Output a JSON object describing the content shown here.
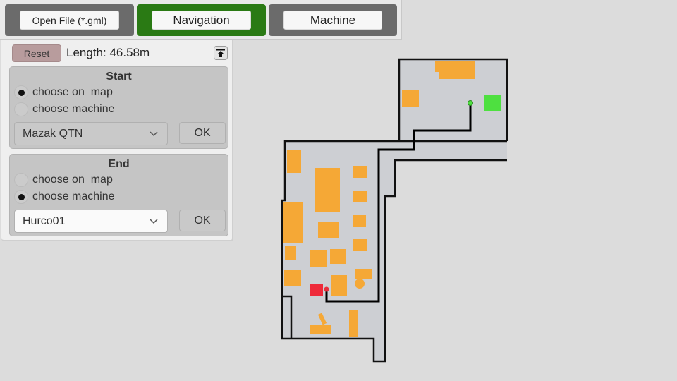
{
  "toolbar": {
    "tabs": [
      {
        "label": "Open File (*.gml)",
        "active": false
      },
      {
        "label": "Navigation",
        "active": true
      },
      {
        "label": "Machine",
        "active": false
      }
    ],
    "active_color": "#2a7a14",
    "inactive_color": "#6b6b6b"
  },
  "panel": {
    "reset_label": "Reset",
    "length_text": "Length: 46.58m",
    "collapse_icon": "collapse-up-arrow-icon",
    "start": {
      "title": "Start",
      "options": [
        {
          "label": "choose on  map",
          "selected": true
        },
        {
          "label": "choose machine",
          "selected": false
        }
      ],
      "machine_select": "Mazak QTN",
      "ok_label": "OK"
    },
    "end": {
      "title": "End",
      "options": [
        {
          "label": "choose on  map",
          "selected": false
        },
        {
          "label": "choose machine",
          "selected": true
        }
      ],
      "machine_select": "Hurco01",
      "ok_label": "OK"
    }
  },
  "map": {
    "floor_color": "#cdcfd3",
    "wall_color": "#111111",
    "machine_color": "#f5a836",
    "start_marker_color": "#4ee040",
    "end_marker_color": "#e8303d",
    "start_machine_color": "#4ee040",
    "end_machine_color": "#ee2a3a",
    "route_color": "#000000"
  }
}
